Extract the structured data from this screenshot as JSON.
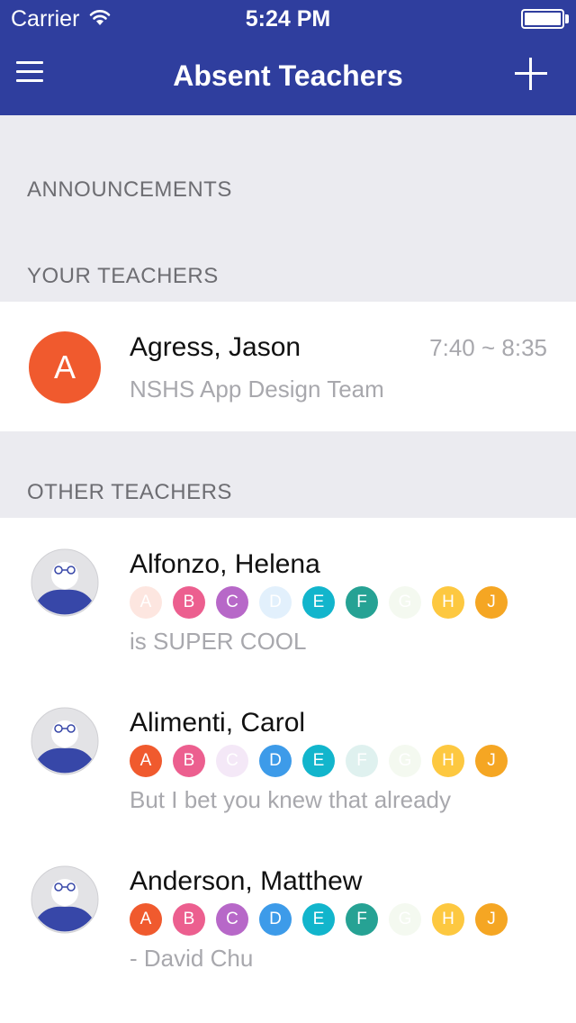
{
  "status_bar": {
    "carrier": "Carrier",
    "time": "5:24 PM"
  },
  "nav": {
    "title": "Absent Teachers",
    "menu_icon": "hamburger-icon",
    "add_icon": "plus-icon"
  },
  "sections": {
    "announcements": "ANNOUNCEMENTS",
    "your_teachers": "YOUR TEACHERS",
    "other_teachers": "OTHER TEACHERS"
  },
  "your_teachers": [
    {
      "initial": "A",
      "name": "Agress, Jason",
      "time": "7:40 ~ 8:35",
      "subtitle": "NSHS App Design Team",
      "avatar_color": "#f05a2e"
    }
  ],
  "period_colors": {
    "A": "#f05a2e",
    "B": "#ec5f8f",
    "C": "#b768c8",
    "D": "#3d9be9",
    "E": "#12b5cc",
    "F": "#26a294",
    "G": "#b6d89a",
    "H": "#fdc840",
    "J": "#f5a623"
  },
  "other_teachers": [
    {
      "name": "Alfonzo, Helena",
      "note": "is SUPER COOL",
      "periods": [
        {
          "label": "A",
          "active": false
        },
        {
          "label": "B",
          "active": true
        },
        {
          "label": "C",
          "active": true
        },
        {
          "label": "D",
          "active": false
        },
        {
          "label": "E",
          "active": true
        },
        {
          "label": "F",
          "active": true
        },
        {
          "label": "G",
          "active": false
        },
        {
          "label": "H",
          "active": true
        },
        {
          "label": "J",
          "active": true
        }
      ]
    },
    {
      "name": "Alimenti, Carol",
      "note": "But I bet you knew that already",
      "periods": [
        {
          "label": "A",
          "active": true
        },
        {
          "label": "B",
          "active": true
        },
        {
          "label": "C",
          "active": false
        },
        {
          "label": "D",
          "active": true
        },
        {
          "label": "E",
          "active": true
        },
        {
          "label": "F",
          "active": false
        },
        {
          "label": "G",
          "active": false
        },
        {
          "label": "H",
          "active": true
        },
        {
          "label": "J",
          "active": true
        }
      ]
    },
    {
      "name": "Anderson, Matthew",
      "note": "- David Chu",
      "periods": [
        {
          "label": "A",
          "active": true
        },
        {
          "label": "B",
          "active": true
        },
        {
          "label": "C",
          "active": true
        },
        {
          "label": "D",
          "active": true
        },
        {
          "label": "E",
          "active": true
        },
        {
          "label": "F",
          "active": true
        },
        {
          "label": "G",
          "active": false
        },
        {
          "label": "H",
          "active": true
        },
        {
          "label": "J",
          "active": true
        }
      ]
    }
  ]
}
